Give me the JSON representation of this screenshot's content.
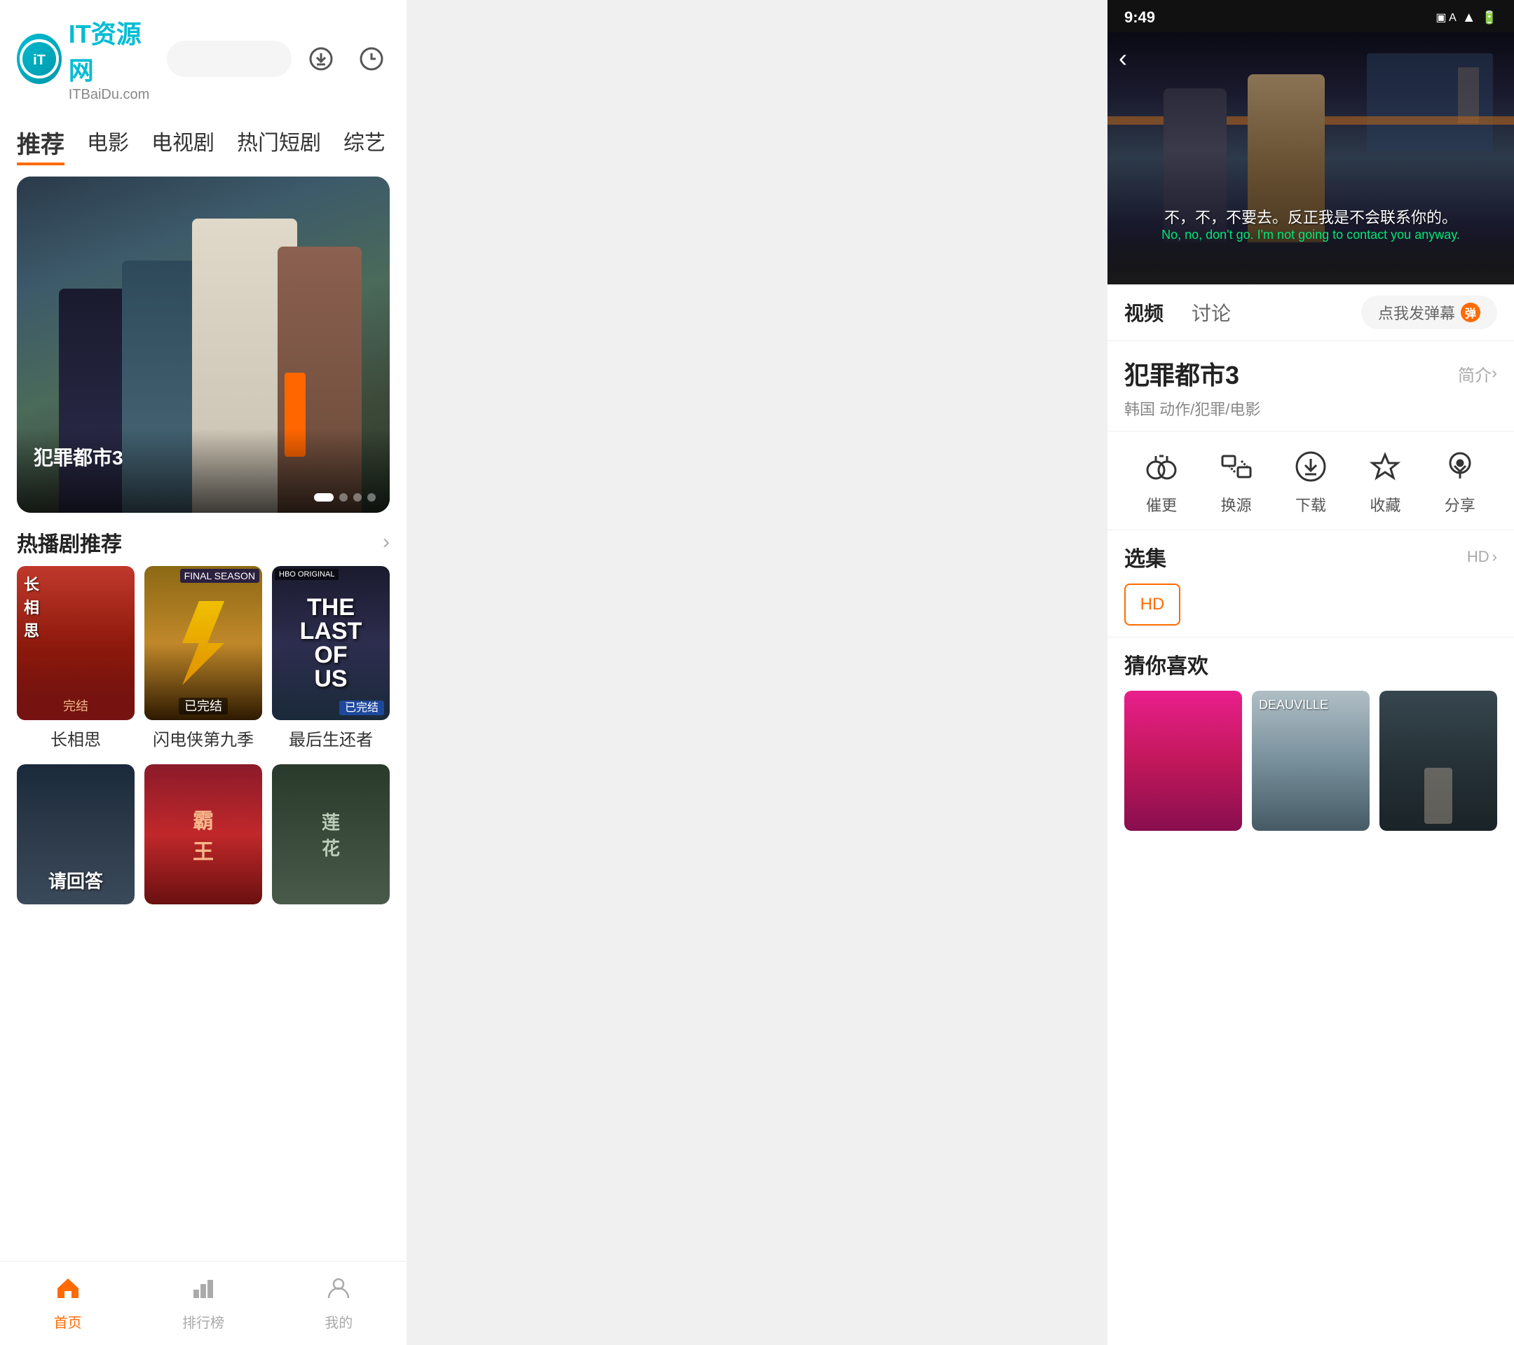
{
  "left": {
    "logo": {
      "icon": "iT",
      "main_text": "IT资源网",
      "sub_text": "ITBaiDu.com"
    },
    "header_icons": {
      "download": "⊕",
      "history": "🕐"
    },
    "nav_tabs": [
      {
        "label": "推荐",
        "active": true
      },
      {
        "label": "电影",
        "active": false
      },
      {
        "label": "电视剧",
        "active": false
      },
      {
        "label": "热门短剧",
        "active": false
      },
      {
        "label": "综艺",
        "active": false
      }
    ],
    "hero": {
      "title": "犯罪都市3",
      "dots": [
        true,
        false,
        false,
        false
      ]
    },
    "hot_section": {
      "title": "热播剧推荐",
      "shows": [
        {
          "name": "长相思",
          "badge": "完结",
          "badge_type": "normal"
        },
        {
          "name": "闪电侠第九季",
          "badge": "已完结",
          "badge_type": "normal"
        },
        {
          "name": "最后生还者",
          "badge": "已完结",
          "badge_type": "blue"
        }
      ]
    },
    "bottom_nav": [
      {
        "icon": "🏠",
        "label": "首页",
        "active": true
      },
      {
        "icon": "📊",
        "label": "排行榜",
        "active": false
      },
      {
        "icon": "😊",
        "label": "我的",
        "active": false
      }
    ]
  },
  "right": {
    "status_bar": {
      "time": "9:49",
      "icons": [
        "📶",
        "🔋"
      ]
    },
    "video": {
      "subtitle_cn": "不，不，不要去。反正我是不会联系你的。",
      "subtitle_en": "No, no, don't go. I'm not going to contact you anyway."
    },
    "tabs": [
      {
        "label": "视频",
        "active": true
      },
      {
        "label": "讨论",
        "active": false
      }
    ],
    "danmu_btn": "点我发弹幕",
    "danmu_badge": "弹",
    "movie": {
      "title": "犯罪都市3",
      "intro_label": "简介",
      "meta": "韩国 动作/犯罪/电影"
    },
    "actions": [
      {
        "icon": "🎧",
        "label": "催更"
      },
      {
        "icon": "⇄",
        "label": "换源"
      },
      {
        "icon": "⬇",
        "label": "下载"
      },
      {
        "icon": "✩",
        "label": "收藏"
      },
      {
        "icon": "↻",
        "label": "分享"
      }
    ],
    "episodes": {
      "title": "选集",
      "hd_label": "HD",
      "items": [
        "HD"
      ]
    },
    "recommend": {
      "title": "猜你喜欢",
      "items": [
        {
          "color": "#e91e8c"
        },
        {
          "color": "#78909c"
        },
        {
          "color": "#37474f"
        }
      ]
    }
  }
}
